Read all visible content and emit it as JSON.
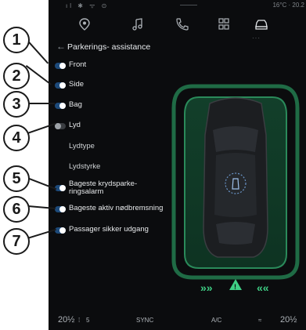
{
  "status_bar": {
    "left_icons": "ıl ✱ ᯤ ⊙",
    "temp_time": "16°C · 20.2"
  },
  "nav": {
    "active_dots": "···"
  },
  "header": {
    "back_symbol": "←",
    "title": "Parkerings- assistance"
  },
  "settings": [
    {
      "label": "Front",
      "on": true
    },
    {
      "label": "Side",
      "on": true
    },
    {
      "label": "Bag",
      "on": true
    },
    {
      "label": "Lyd",
      "on": false
    },
    {
      "label": "Lydtype"
    },
    {
      "label": "Lydstyrke"
    },
    {
      "label": "Bageste krydsparke-\nringsalarm",
      "on": true
    },
    {
      "label": "Bageste aktiv nødbremsning",
      "on": true
    },
    {
      "label": "Passager sikker udgang",
      "on": true
    }
  ],
  "bottom_bar": {
    "left_temp": "20½",
    "fan": "5",
    "sync": "SYNC",
    "ac": "A/C",
    "right_temp": "20½"
  },
  "callouts": [
    "1",
    "2",
    "3",
    "4",
    "5",
    "6",
    "7"
  ],
  "colors": {
    "toggle_on": "#1d4a7a",
    "sensor_green": "#1f6b45",
    "screen_bg": "#0b0c0e"
  },
  "icons": {
    "nav": [
      "location-pin-icon",
      "music-note-icon",
      "phone-icon",
      "apps-grid-icon",
      "car-icon"
    ]
  }
}
